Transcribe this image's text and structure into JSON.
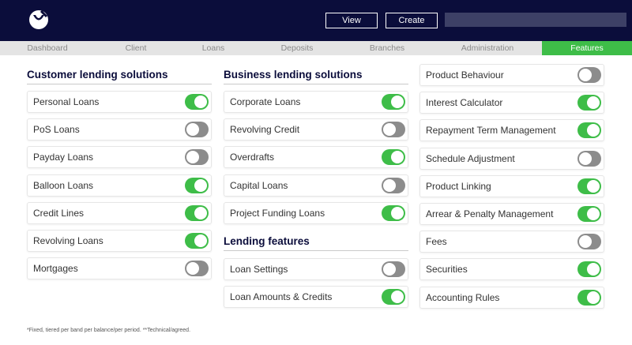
{
  "header": {
    "logo": "brand-logo",
    "view_label": "View",
    "create_label": "Create",
    "search_value": ""
  },
  "nav": {
    "items": [
      {
        "label": "Dashboard"
      },
      {
        "label": "Client"
      },
      {
        "label": "Loans"
      },
      {
        "label": "Deposits"
      },
      {
        "label": "Branches"
      },
      {
        "label": "Administration"
      },
      {
        "label": "Features",
        "active": true
      }
    ]
  },
  "customer": {
    "title": "Customer lending solutions",
    "items": [
      {
        "label": "Personal Loans",
        "on": true
      },
      {
        "label": "PoS Loans",
        "on": false
      },
      {
        "label": "Payday Loans",
        "on": false
      },
      {
        "label": "Balloon Loans",
        "on": true
      },
      {
        "label": "Credit Lines",
        "on": true
      },
      {
        "label": "Revolving Loans",
        "on": true
      },
      {
        "label": "Mortgages",
        "on": false
      }
    ]
  },
  "business": {
    "title": "Business lending solutions",
    "items": [
      {
        "label": "Corporate Loans",
        "on": true
      },
      {
        "label": "Revolving Credit",
        "on": false
      },
      {
        "label": "Overdrafts",
        "on": true
      },
      {
        "label": "Capital Loans",
        "on": false
      },
      {
        "label": "Project Funding Loans",
        "on": true
      }
    ]
  },
  "lending_features": {
    "title": "Lending features",
    "items": [
      {
        "label": "Loan Settings",
        "on": false
      },
      {
        "label": "Loan Amounts & Credits",
        "on": true
      }
    ]
  },
  "product": {
    "items": [
      {
        "label": "Product Behaviour",
        "on": false
      },
      {
        "label": "Interest Calculator",
        "on": true
      },
      {
        "label": "Repayment Term Management",
        "on": true
      },
      {
        "label": "Schedule Adjustment",
        "on": false
      },
      {
        "label": "Product Linking",
        "on": true
      },
      {
        "label": "Arrear & Penalty Management",
        "on": true
      },
      {
        "label": "Fees",
        "on": false
      },
      {
        "label": "Securities",
        "on": true
      },
      {
        "label": "Accounting Rules",
        "on": true
      }
    ]
  },
  "footnote": "*Fixed, tiered per band per balance/per period.   **Technical/agreed.",
  "colors": {
    "header_bg": "#0b0d3b",
    "accent_green": "#3ebd48",
    "toggle_off": "#8c8c8c"
  }
}
